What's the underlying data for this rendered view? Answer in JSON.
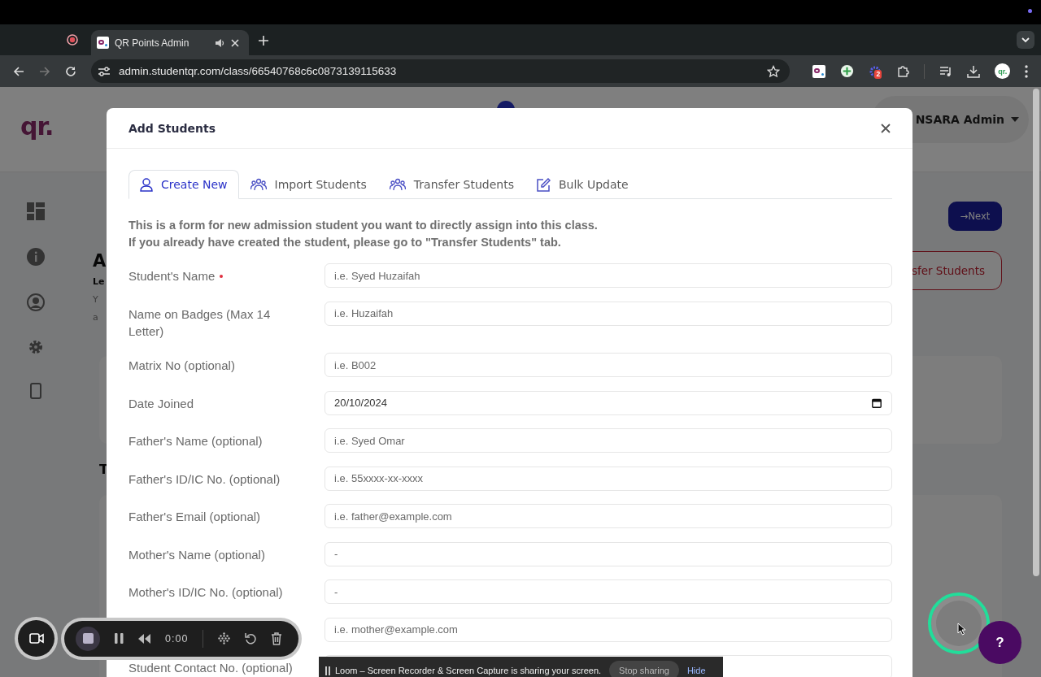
{
  "browser": {
    "tabs": [
      {
        "title": "QR Points Admin",
        "selected": true
      }
    ],
    "url": "admin.studentqr.com/class/66540768c6c0873139115633",
    "extension_badge": "2",
    "profile": "qr."
  },
  "app": {
    "logo": "qr.",
    "user": "NSARA Admin",
    "next_button": "→Next",
    "transfer_button": "sfer Students",
    "title_fragment": "A",
    "text_fragments": [
      {
        "text": "Le",
        "kind": "bold"
      },
      {
        "text": "Y",
        "kind": "plain"
      },
      {
        "text": "a",
        "kind": "plain"
      }
    ],
    "section_fragment": "T"
  },
  "modal": {
    "title": "Add Students",
    "tabs": [
      {
        "label": "Create New",
        "kind": "person",
        "selected": true
      },
      {
        "label": "Import Students",
        "kind": "group",
        "selected": false
      },
      {
        "label": "Transfer Students",
        "kind": "group",
        "selected": false
      },
      {
        "label": "Bulk Update",
        "kind": "edit",
        "selected": false
      }
    ],
    "intro": [
      "This is a form for new admission student you want to directly assign into this class.",
      "If you already have created the student, please go to \"Transfer Students\" tab."
    ],
    "fields": [
      {
        "label": "Student's Name",
        "kind": "text",
        "placeholder": "i.e. Syed Huzaifah",
        "required": true
      },
      {
        "label": "Name on Badges (Max 14 Letter)",
        "kind": "text",
        "placeholder": "i.e. Huzaifah",
        "required": false
      },
      {
        "label": "Matrix No (optional)",
        "kind": "text",
        "placeholder": "i.e. B002",
        "required": false
      },
      {
        "label": "Date Joined",
        "kind": "date",
        "value": "20/10/2024",
        "required": false
      },
      {
        "label": "Father's Name (optional)",
        "kind": "text",
        "placeholder": "i.e. Syed Omar",
        "required": false
      },
      {
        "label": "Father's ID/IC No. (optional)",
        "kind": "text",
        "placeholder": "i.e. 55xxxx-xx-xxxx",
        "required": false
      },
      {
        "label": "Father's Email (optional)",
        "kind": "text",
        "placeholder": "i.e. father@example.com",
        "required": false
      },
      {
        "label": "Mother's Name (optional)",
        "kind": "text",
        "placeholder": "-",
        "required": false
      },
      {
        "label": "Mother's ID/IC No. (optional)",
        "kind": "text",
        "placeholder": "-",
        "required": false
      },
      {
        "kind": "text",
        "placeholder": "i.e. mother@example.com",
        "required": false
      },
      {
        "label": "Student Contact No. (optional)",
        "kind": "text",
        "required": false
      }
    ]
  },
  "recorder": {
    "time": "0:00"
  },
  "share_bar": {
    "message": "Loom – Screen Recorder & Screen Capture is sharing your screen.",
    "stop_button": "Stop sharing",
    "hide_link": "Hide"
  },
  "help_button": "?"
}
